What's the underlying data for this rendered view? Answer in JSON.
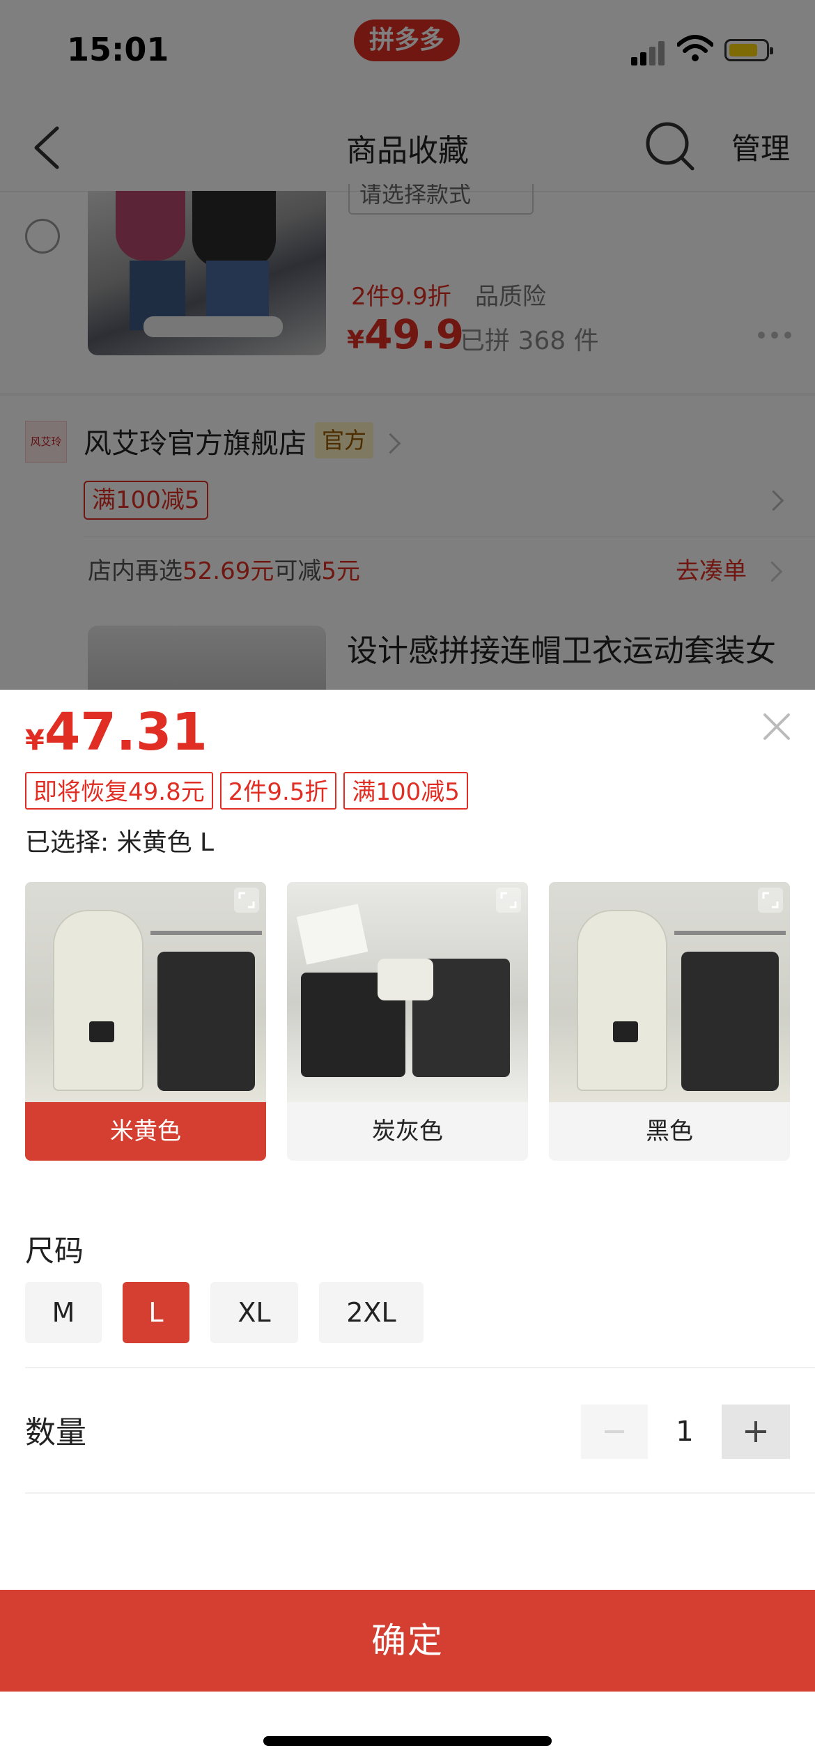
{
  "status_bar": {
    "time": "15:01",
    "app_badge": "拼多多"
  },
  "nav": {
    "title": "商品收藏",
    "manage": "管理"
  },
  "product1": {
    "style_select": "请选择款式",
    "promo": "2件9.9折",
    "insurance": "品质险",
    "price_currency": "¥",
    "price": "49.9",
    "sold": "已拼 368 件"
  },
  "store": {
    "logo_text": "风艾玲",
    "name": "风艾玲官方旗舰店",
    "official_badge": "官方",
    "coupon": "满100减5",
    "tip_prefix": "店内再选",
    "tip_amount": "52.69元",
    "tip_middle": "可减",
    "tip_discount": "5元",
    "go_order": "去凑单"
  },
  "product2": {
    "title": "设计感拼接连帽卫衣运动套装女"
  },
  "sheet": {
    "price_currency": "¥",
    "price": "47.31",
    "tags": [
      "即将恢复49.8元",
      "2件9.5折",
      "满100减5"
    ],
    "selected_label": "已选择: 米黄色 L",
    "colors": [
      {
        "label": "米黄色",
        "selected": true
      },
      {
        "label": "炭灰色",
        "selected": false
      },
      {
        "label": "黑色",
        "selected": false
      }
    ],
    "size_title": "尺码",
    "sizes": [
      {
        "label": "M",
        "selected": false
      },
      {
        "label": "L",
        "selected": true
      },
      {
        "label": "XL",
        "selected": false
      },
      {
        "label": "2XL",
        "selected": false
      }
    ],
    "quantity_title": "数量",
    "quantity": "1",
    "confirm": "确定",
    "accent_color": "#d53f31"
  }
}
